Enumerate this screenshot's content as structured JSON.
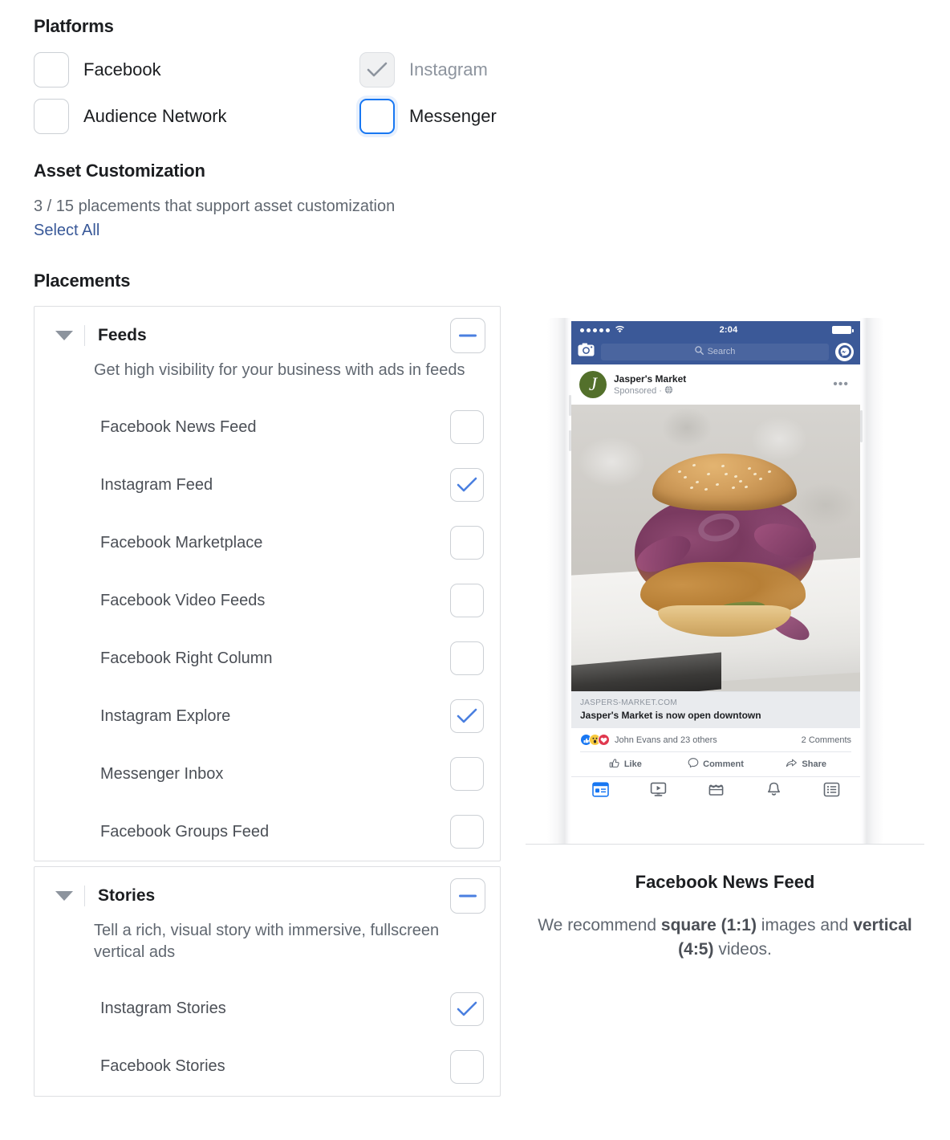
{
  "platforms": {
    "heading": "Platforms",
    "items": [
      {
        "label": "Facebook",
        "checked": false,
        "disabled": false,
        "focused": false
      },
      {
        "label": "Instagram",
        "checked": true,
        "disabled": true,
        "focused": false
      },
      {
        "label": "Audience Network",
        "checked": false,
        "disabled": false,
        "focused": false
      },
      {
        "label": "Messenger",
        "checked": false,
        "disabled": false,
        "focused": true
      }
    ]
  },
  "asset_customization": {
    "heading": "Asset Customization",
    "summary": "3 / 15 placements that support asset customization",
    "select_all_label": "Select All"
  },
  "placements": {
    "heading": "Placements",
    "groups": [
      {
        "title": "Feeds",
        "description": "Get high visibility for your business with ads in feeds",
        "toggle_state": "indeterminate",
        "items": [
          {
            "label": "Facebook News Feed",
            "checked": false
          },
          {
            "label": "Instagram Feed",
            "checked": true
          },
          {
            "label": "Facebook Marketplace",
            "checked": false
          },
          {
            "label": "Facebook Video Feeds",
            "checked": false
          },
          {
            "label": "Facebook Right Column",
            "checked": false
          },
          {
            "label": "Instagram Explore",
            "checked": true
          },
          {
            "label": "Messenger Inbox",
            "checked": false
          },
          {
            "label": "Facebook Groups Feed",
            "checked": false
          }
        ]
      },
      {
        "title": "Stories",
        "description": "Tell a rich, visual story with immersive, fullscreen vertical ads",
        "toggle_state": "indeterminate",
        "items": [
          {
            "label": "Instagram Stories",
            "checked": true
          },
          {
            "label": "Facebook Stories",
            "checked": false
          }
        ]
      }
    ]
  },
  "preview": {
    "phone": {
      "status_bar": {
        "time": "2:04",
        "signal_dots": 5
      },
      "nav": {
        "search_placeholder": "Search"
      },
      "post": {
        "page_name": "Jasper's Market",
        "avatar_letter": "J",
        "meta": "Sponsored ·",
        "link_domain": "JASPERS-MARKET.COM",
        "link_title": "Jasper's Market is now open downtown",
        "reactions_text": "John Evans and 23 others",
        "comments_text": "2 Comments",
        "actions": [
          "Like",
          "Comment",
          "Share"
        ]
      },
      "tabs": [
        "news-feed-icon",
        "watch-icon",
        "marketplace-icon",
        "notifications-icon",
        "menu-icon"
      ]
    },
    "title": "Facebook News Feed",
    "description_parts": [
      {
        "text": "We recommend ",
        "bold": false
      },
      {
        "text": "square (1:1)",
        "bold": true
      },
      {
        "text": " images and ",
        "bold": false
      },
      {
        "text": "vertical (4:5)",
        "bold": true
      },
      {
        "text": " videos.",
        "bold": false
      }
    ]
  },
  "colors": {
    "accent_blue": "#1877f2",
    "link_blue": "#385898",
    "facebook_navy": "#3b5998",
    "text_primary": "#1c1e21",
    "text_secondary": "#606770",
    "border": "#ccd0d5"
  }
}
